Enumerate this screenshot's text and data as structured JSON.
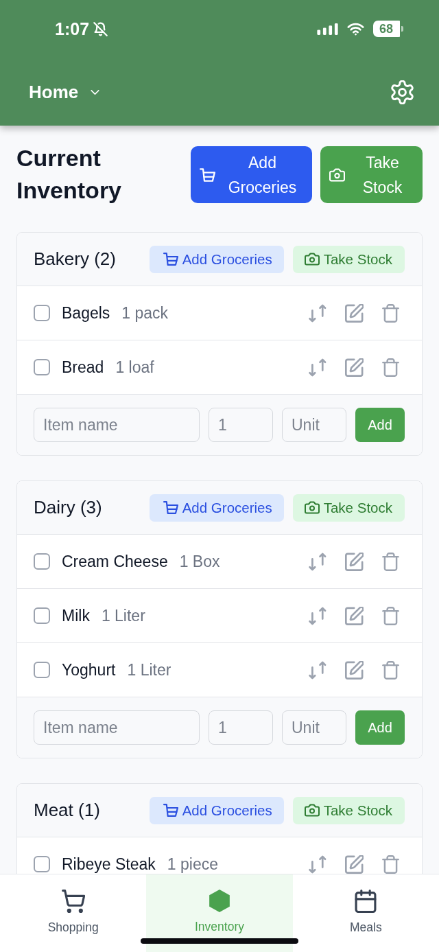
{
  "status_bar": {
    "time": "1:07",
    "battery": "68"
  },
  "nav": {
    "title": "Home"
  },
  "page": {
    "title": "Current Inventory",
    "actions": [
      {
        "kind": "groceries",
        "label": "Add Groceries"
      },
      {
        "kind": "stock",
        "label": "Take Stock"
      }
    ]
  },
  "categories": [
    {
      "title": "Bakery (2)",
      "actions": [
        {
          "kind": "groceries",
          "label": "Add Groceries"
        },
        {
          "kind": "stock",
          "label": "Take Stock"
        }
      ],
      "items": [
        {
          "name": "Bagels",
          "quantity": "1 pack",
          "checked": false
        },
        {
          "name": "Bread",
          "quantity": "1 loaf",
          "checked": false
        }
      ],
      "add_form": {
        "fields": [
          {
            "kind": "name",
            "placeholder": "Item name"
          },
          {
            "kind": "quantity",
            "placeholder": "1"
          },
          {
            "kind": "unit",
            "placeholder": "Unit"
          }
        ],
        "button": "Add"
      }
    },
    {
      "title": "Dairy (3)",
      "actions": [
        {
          "kind": "groceries",
          "label": "Add Groceries"
        },
        {
          "kind": "stock",
          "label": "Take Stock"
        }
      ],
      "items": [
        {
          "name": "Cream Cheese",
          "quantity": "1 Box",
          "checked": false
        },
        {
          "name": "Milk",
          "quantity": "1 Liter",
          "checked": false
        },
        {
          "name": "Yoghurt",
          "quantity": "1 Liter",
          "checked": false
        }
      ],
      "add_form": {
        "fields": [
          {
            "kind": "name",
            "placeholder": "Item name"
          },
          {
            "kind": "quantity",
            "placeholder": "1"
          },
          {
            "kind": "unit",
            "placeholder": "Unit"
          }
        ],
        "button": "Add"
      }
    },
    {
      "title": "Meat (1)",
      "actions": [
        {
          "kind": "groceries",
          "label": "Add Groceries"
        },
        {
          "kind": "stock",
          "label": "Take Stock"
        }
      ],
      "items": [
        {
          "name": "Ribeye Steak",
          "quantity": "1 piece",
          "checked": false
        }
      ]
    }
  ],
  "tab_bar": [
    {
      "kind": "shopping",
      "label": "Shopping",
      "selected": false
    },
    {
      "kind": "inventory",
      "label": "Inventory",
      "selected": true
    },
    {
      "kind": "meals",
      "label": "Meals",
      "selected": false
    }
  ]
}
